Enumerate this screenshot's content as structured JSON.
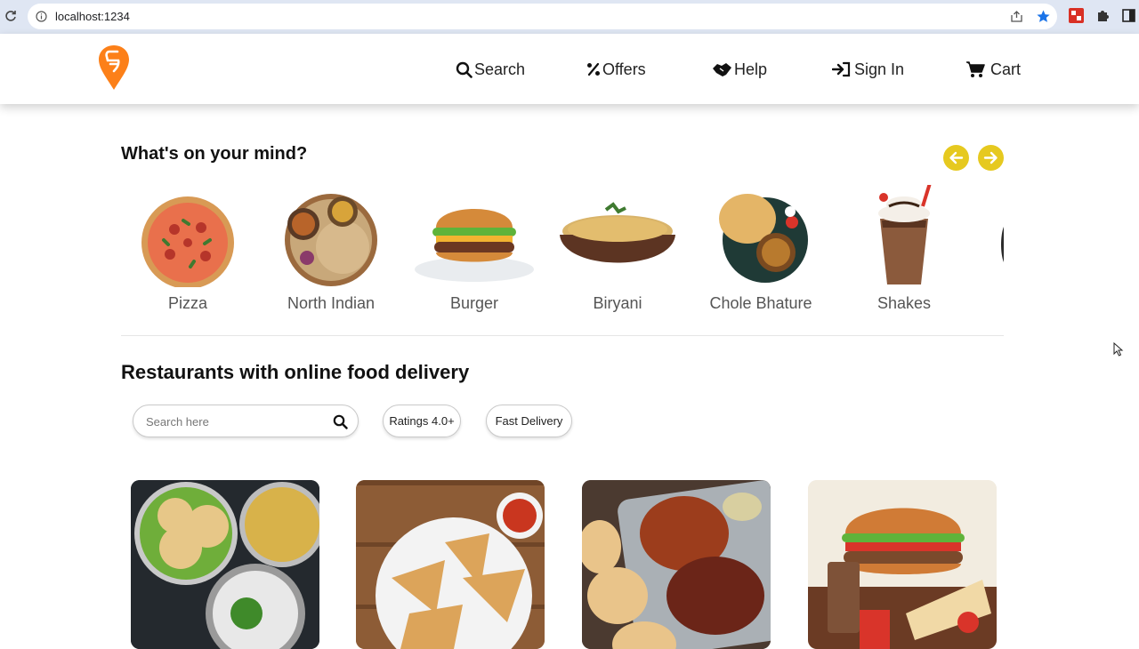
{
  "browser": {
    "url": "localhost:1234",
    "icons": [
      "reload-icon",
      "info-icon",
      "share-icon",
      "star-icon",
      "extension-icon",
      "puzzle-icon",
      "side-panel-icon"
    ]
  },
  "header": {
    "logo": "swiggy-logo",
    "nav": {
      "search": "Search",
      "offers": "Offers",
      "help": "Help",
      "signin": "Sign In",
      "cart": "Cart"
    }
  },
  "mind": {
    "title": "What's on your mind?",
    "items": [
      {
        "label": "Pizza"
      },
      {
        "label": "North Indian"
      },
      {
        "label": "Burger"
      },
      {
        "label": "Biryani"
      },
      {
        "label": "Chole Bhature"
      },
      {
        "label": "Shakes"
      }
    ]
  },
  "restaurants": {
    "title": "Restaurants with online food delivery",
    "search_placeholder": "Search here",
    "filters": {
      "ratings": "Ratings 4.0+",
      "fast": "Fast Delivery"
    }
  },
  "colors": {
    "brand": "#fc8019",
    "arrow_button": "#e6c91f",
    "star": "#1a73e8"
  }
}
